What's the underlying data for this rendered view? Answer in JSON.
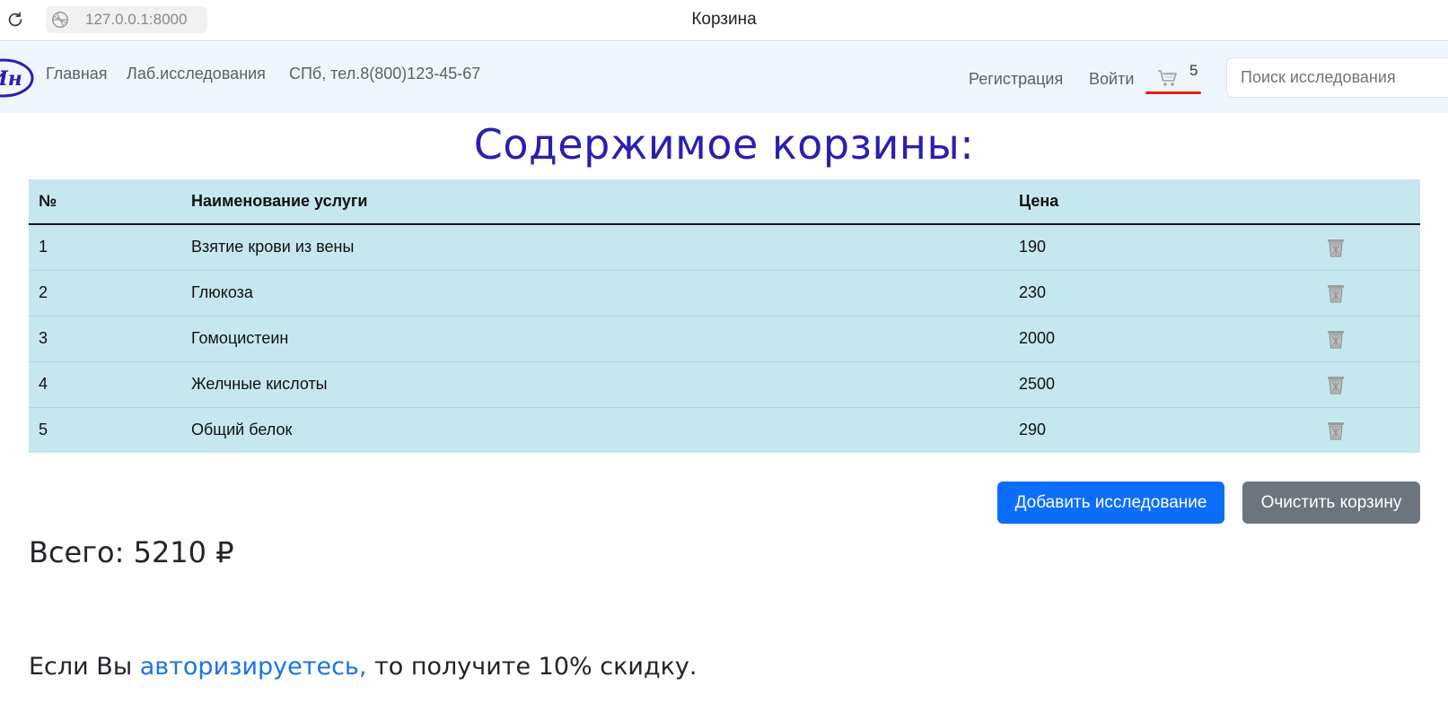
{
  "browser": {
    "url": "127.0.0.1:8000",
    "tab_title": "Корзина"
  },
  "navbar": {
    "links": [
      "Главная",
      "Лаб.исследования",
      "СПб, тел.8(800)123-45-67"
    ],
    "register": "Регистрация",
    "login": "Войти",
    "cart_count": "5",
    "search_placeholder": "Поиск исследования"
  },
  "main": {
    "title": "Содержимое корзины:",
    "table": {
      "headers": [
        "№",
        "Наименование услуги",
        "Цена",
        ""
      ],
      "rows": [
        {
          "num": "1",
          "name": "Взятие крови из вены",
          "price": "190"
        },
        {
          "num": "2",
          "name": "Глюкоза",
          "price": "230"
        },
        {
          "num": "3",
          "name": "Гомоцистеин",
          "price": "2000"
        },
        {
          "num": "4",
          "name": "Желчные кислоты",
          "price": "2500"
        },
        {
          "num": "5",
          "name": "Общий белок",
          "price": "290"
        }
      ]
    },
    "add_button": "Добавить исследование",
    "clear_button": "Очистить корзину",
    "total": "Всего: 5210 ₽",
    "promo": {
      "before": "Если Вы ",
      "link": "авторизируетесь,",
      "after": " то получите 10% скидку."
    }
  },
  "colors": {
    "title": "#2a1eb0",
    "table_bg": "#c5e8ee",
    "primary": "#0d6efd",
    "secondary": "#6c757d",
    "cart_underline": "#e11d1d"
  },
  "icons": [
    "reload-icon",
    "site-icon",
    "logo",
    "cart-icon",
    "trash-icon"
  ]
}
